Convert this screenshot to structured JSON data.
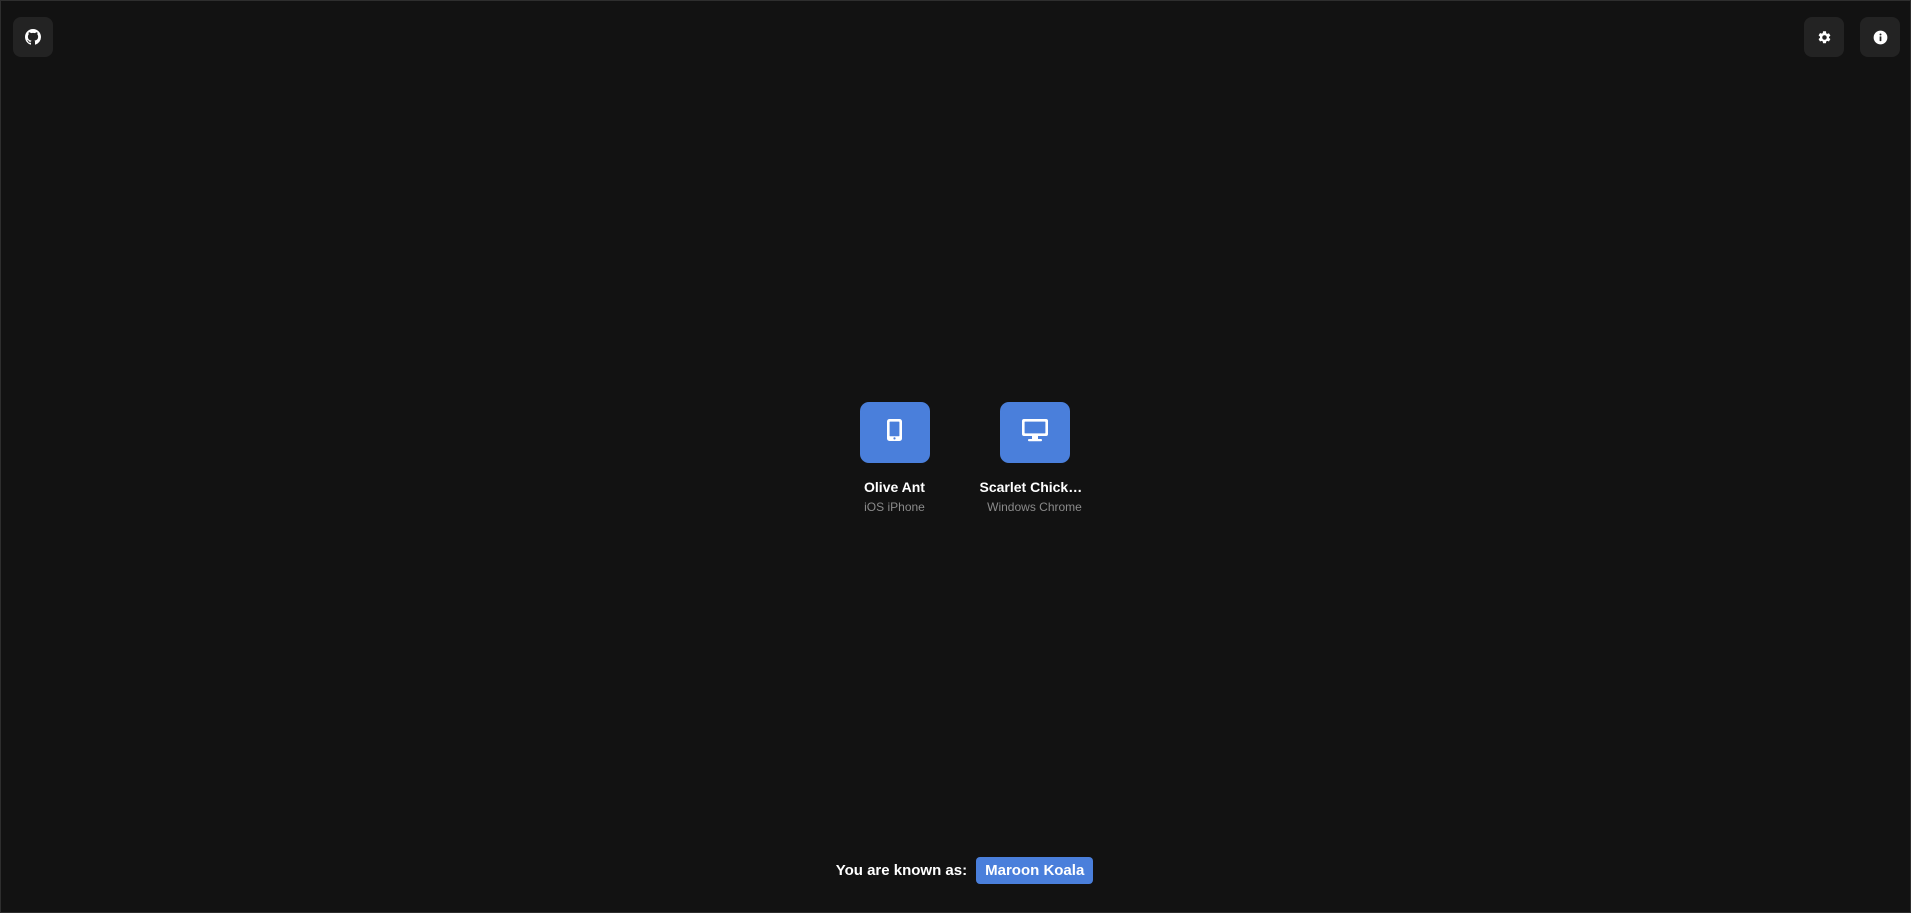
{
  "toolbar": {
    "github_icon": "github-icon",
    "settings_icon": "gear-icon",
    "info_icon": "info-icon"
  },
  "peers": [
    {
      "name": "Olive Ant",
      "device": "iOS iPhone",
      "icon": "smartphone-icon"
    },
    {
      "name": "Scarlet Chickad...",
      "device": "Windows Chrome",
      "icon": "desktop-monitor-icon"
    }
  ],
  "footer": {
    "label": "You are known as:",
    "display_name": "Maroon Koala"
  },
  "colors": {
    "background": "#121212",
    "accent": "#4a7fdb",
    "button_bg": "#232323",
    "muted_text": "#8a8a8a"
  }
}
